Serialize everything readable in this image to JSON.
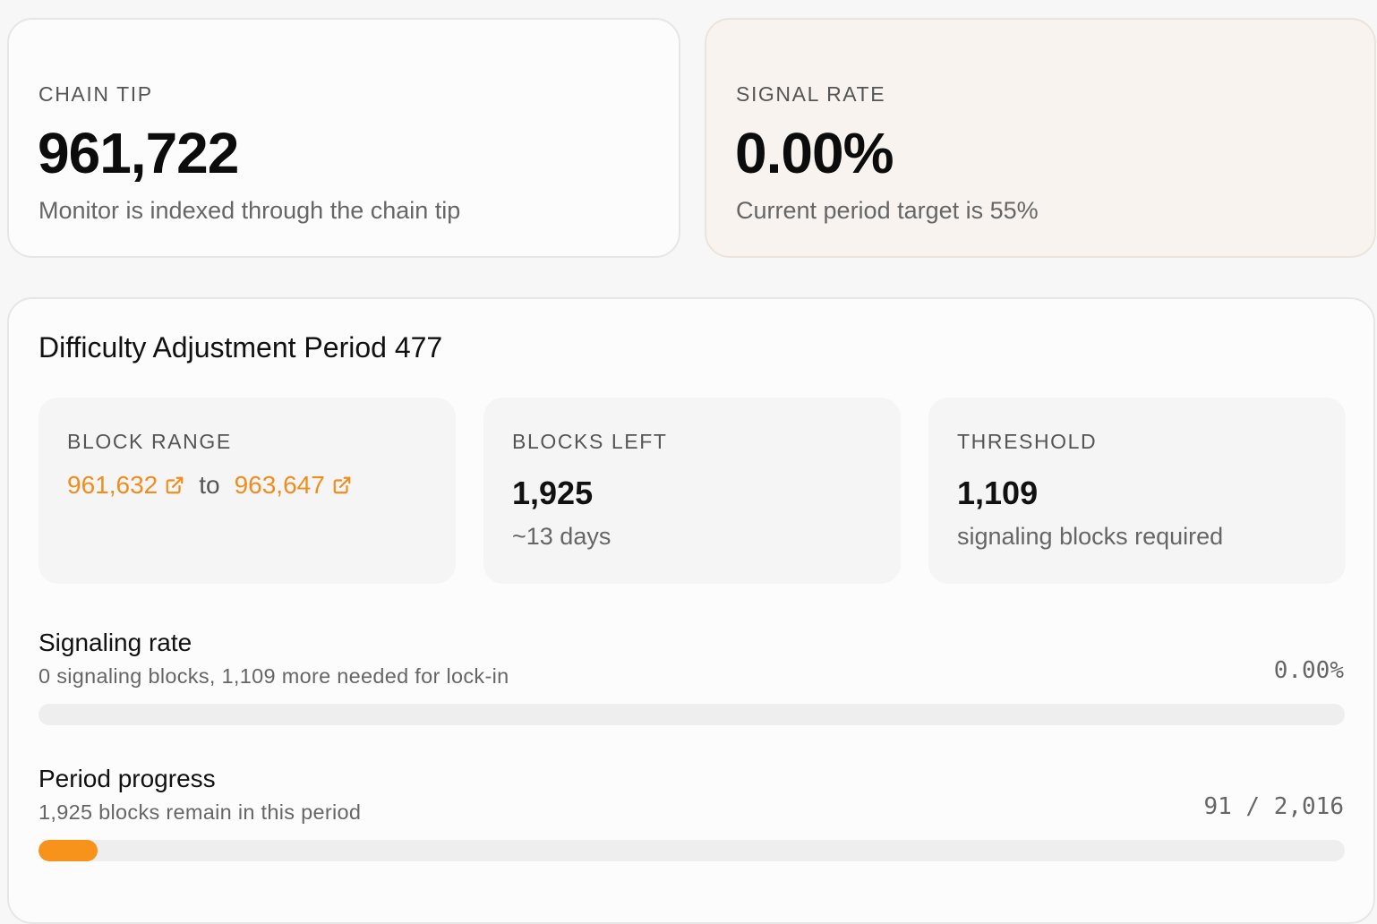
{
  "chain_tip": {
    "label": "CHAIN TIP",
    "value": "961,722",
    "note": "Monitor is indexed through the chain tip"
  },
  "signal_rate": {
    "label": "SIGNAL RATE",
    "value": "0.00%",
    "note": "Current period target is 55%"
  },
  "period": {
    "title": "Difficulty Adjustment Period 477",
    "block_range": {
      "label": "BLOCK RANGE",
      "start": "961,632",
      "separator": "to",
      "end": "963,647"
    },
    "blocks_left": {
      "label": "BLOCKS LEFT",
      "value": "1,925",
      "note": "~13 days"
    },
    "threshold": {
      "label": "THRESHOLD",
      "value": "1,109",
      "note": "signaling blocks required"
    },
    "signaling_meter": {
      "title": "Signaling rate",
      "description": "0 signaling blocks, 1,109 more needed for lock-in",
      "value_text": "0.00%",
      "fraction": 0.0
    },
    "progress_meter": {
      "title": "Period progress",
      "description": "1,925 blocks remain in this period",
      "value_text": "91 / 2,016",
      "fraction": 0.0451
    }
  },
  "colors": {
    "accent": "#f7931a",
    "link": "#f08d1e",
    "signal_card_bg": "#f8f3ee"
  },
  "icons": {
    "external_link": "external-link-icon"
  }
}
